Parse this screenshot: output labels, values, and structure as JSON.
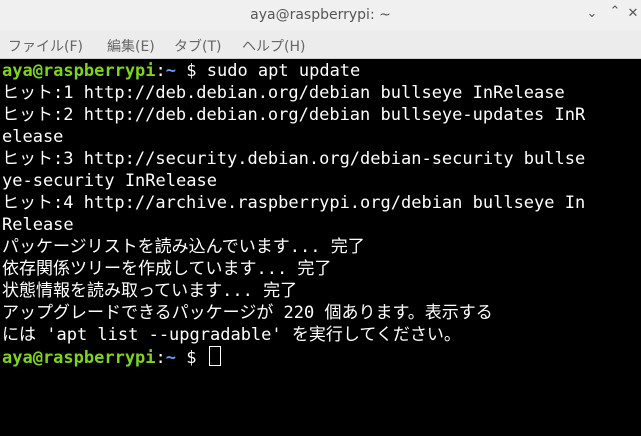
{
  "window": {
    "title": "aya@raspberrypi: ~"
  },
  "menu": {
    "file": "ファイル(F)",
    "edit": "編集(E)",
    "tabs": "タブ(T)",
    "help": "ヘルプ(H)"
  },
  "terminal": {
    "prompt_user_host": "aya@raspberrypi",
    "prompt_sep": ":",
    "prompt_path": "~",
    "prompt_symbol": " $ ",
    "command_1": "sudo apt update",
    "output": [
      "ヒット:1 http://deb.debian.org/debian bullseye InRelease",
      "ヒット:2 http://deb.debian.org/debian bullseye-updates InR",
      "elease",
      "ヒット:3 http://security.debian.org/debian-security bullse",
      "ye-security InRelease",
      "ヒット:4 http://archive.raspberrypi.org/debian bullseye In",
      "Release",
      "パッケージリストを読み込んでいます... 完了",
      "依存関係ツリーを作成しています... 完了",
      "状態情報を読み取っています... 完了",
      "アップグレードできるパッケージが 220 個あります。表示する",
      "には 'apt list --upgradable' を実行してください。"
    ]
  },
  "colors": {
    "prompt_user": "#7ed321",
    "prompt_path": "#6b9cff",
    "text": "#ffffff",
    "background": "#000000"
  }
}
